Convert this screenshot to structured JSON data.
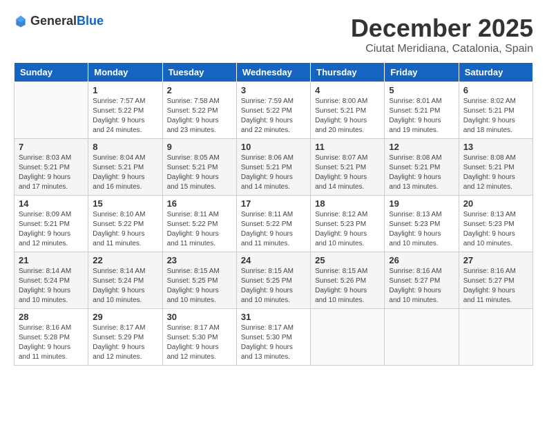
{
  "header": {
    "logo_general": "General",
    "logo_blue": "Blue",
    "month": "December 2025",
    "location": "Ciutat Meridiana, Catalonia, Spain"
  },
  "weekdays": [
    "Sunday",
    "Monday",
    "Tuesday",
    "Wednesday",
    "Thursday",
    "Friday",
    "Saturday"
  ],
  "weeks": [
    [
      {
        "day": "",
        "sunrise": "",
        "sunset": "",
        "daylight": ""
      },
      {
        "day": "1",
        "sunrise": "Sunrise: 7:57 AM",
        "sunset": "Sunset: 5:22 PM",
        "daylight": "Daylight: 9 hours and 24 minutes."
      },
      {
        "day": "2",
        "sunrise": "Sunrise: 7:58 AM",
        "sunset": "Sunset: 5:22 PM",
        "daylight": "Daylight: 9 hours and 23 minutes."
      },
      {
        "day": "3",
        "sunrise": "Sunrise: 7:59 AM",
        "sunset": "Sunset: 5:22 PM",
        "daylight": "Daylight: 9 hours and 22 minutes."
      },
      {
        "day": "4",
        "sunrise": "Sunrise: 8:00 AM",
        "sunset": "Sunset: 5:21 PM",
        "daylight": "Daylight: 9 hours and 20 minutes."
      },
      {
        "day": "5",
        "sunrise": "Sunrise: 8:01 AM",
        "sunset": "Sunset: 5:21 PM",
        "daylight": "Daylight: 9 hours and 19 minutes."
      },
      {
        "day": "6",
        "sunrise": "Sunrise: 8:02 AM",
        "sunset": "Sunset: 5:21 PM",
        "daylight": "Daylight: 9 hours and 18 minutes."
      }
    ],
    [
      {
        "day": "7",
        "sunrise": "Sunrise: 8:03 AM",
        "sunset": "Sunset: 5:21 PM",
        "daylight": "Daylight: 9 hours and 17 minutes."
      },
      {
        "day": "8",
        "sunrise": "Sunrise: 8:04 AM",
        "sunset": "Sunset: 5:21 PM",
        "daylight": "Daylight: 9 hours and 16 minutes."
      },
      {
        "day": "9",
        "sunrise": "Sunrise: 8:05 AM",
        "sunset": "Sunset: 5:21 PM",
        "daylight": "Daylight: 9 hours and 15 minutes."
      },
      {
        "day": "10",
        "sunrise": "Sunrise: 8:06 AM",
        "sunset": "Sunset: 5:21 PM",
        "daylight": "Daylight: 9 hours and 14 minutes."
      },
      {
        "day": "11",
        "sunrise": "Sunrise: 8:07 AM",
        "sunset": "Sunset: 5:21 PM",
        "daylight": "Daylight: 9 hours and 14 minutes."
      },
      {
        "day": "12",
        "sunrise": "Sunrise: 8:08 AM",
        "sunset": "Sunset: 5:21 PM",
        "daylight": "Daylight: 9 hours and 13 minutes."
      },
      {
        "day": "13",
        "sunrise": "Sunrise: 8:08 AM",
        "sunset": "Sunset: 5:21 PM",
        "daylight": "Daylight: 9 hours and 12 minutes."
      }
    ],
    [
      {
        "day": "14",
        "sunrise": "Sunrise: 8:09 AM",
        "sunset": "Sunset: 5:21 PM",
        "daylight": "Daylight: 9 hours and 12 minutes."
      },
      {
        "day": "15",
        "sunrise": "Sunrise: 8:10 AM",
        "sunset": "Sunset: 5:22 PM",
        "daylight": "Daylight: 9 hours and 11 minutes."
      },
      {
        "day": "16",
        "sunrise": "Sunrise: 8:11 AM",
        "sunset": "Sunset: 5:22 PM",
        "daylight": "Daylight: 9 hours and 11 minutes."
      },
      {
        "day": "17",
        "sunrise": "Sunrise: 8:11 AM",
        "sunset": "Sunset: 5:22 PM",
        "daylight": "Daylight: 9 hours and 11 minutes."
      },
      {
        "day": "18",
        "sunrise": "Sunrise: 8:12 AM",
        "sunset": "Sunset: 5:23 PM",
        "daylight": "Daylight: 9 hours and 10 minutes."
      },
      {
        "day": "19",
        "sunrise": "Sunrise: 8:13 AM",
        "sunset": "Sunset: 5:23 PM",
        "daylight": "Daylight: 9 hours and 10 minutes."
      },
      {
        "day": "20",
        "sunrise": "Sunrise: 8:13 AM",
        "sunset": "Sunset: 5:23 PM",
        "daylight": "Daylight: 9 hours and 10 minutes."
      }
    ],
    [
      {
        "day": "21",
        "sunrise": "Sunrise: 8:14 AM",
        "sunset": "Sunset: 5:24 PM",
        "daylight": "Daylight: 9 hours and 10 minutes."
      },
      {
        "day": "22",
        "sunrise": "Sunrise: 8:14 AM",
        "sunset": "Sunset: 5:24 PM",
        "daylight": "Daylight: 9 hours and 10 minutes."
      },
      {
        "day": "23",
        "sunrise": "Sunrise: 8:15 AM",
        "sunset": "Sunset: 5:25 PM",
        "daylight": "Daylight: 9 hours and 10 minutes."
      },
      {
        "day": "24",
        "sunrise": "Sunrise: 8:15 AM",
        "sunset": "Sunset: 5:25 PM",
        "daylight": "Daylight: 9 hours and 10 minutes."
      },
      {
        "day": "25",
        "sunrise": "Sunrise: 8:15 AM",
        "sunset": "Sunset: 5:26 PM",
        "daylight": "Daylight: 9 hours and 10 minutes."
      },
      {
        "day": "26",
        "sunrise": "Sunrise: 8:16 AM",
        "sunset": "Sunset: 5:27 PM",
        "daylight": "Daylight: 9 hours and 10 minutes."
      },
      {
        "day": "27",
        "sunrise": "Sunrise: 8:16 AM",
        "sunset": "Sunset: 5:27 PM",
        "daylight": "Daylight: 9 hours and 11 minutes."
      }
    ],
    [
      {
        "day": "28",
        "sunrise": "Sunrise: 8:16 AM",
        "sunset": "Sunset: 5:28 PM",
        "daylight": "Daylight: 9 hours and 11 minutes."
      },
      {
        "day": "29",
        "sunrise": "Sunrise: 8:17 AM",
        "sunset": "Sunset: 5:29 PM",
        "daylight": "Daylight: 9 hours and 12 minutes."
      },
      {
        "day": "30",
        "sunrise": "Sunrise: 8:17 AM",
        "sunset": "Sunset: 5:30 PM",
        "daylight": "Daylight: 9 hours and 12 minutes."
      },
      {
        "day": "31",
        "sunrise": "Sunrise: 8:17 AM",
        "sunset": "Sunset: 5:30 PM",
        "daylight": "Daylight: 9 hours and 13 minutes."
      },
      {
        "day": "",
        "sunrise": "",
        "sunset": "",
        "daylight": ""
      },
      {
        "day": "",
        "sunrise": "",
        "sunset": "",
        "daylight": ""
      },
      {
        "day": "",
        "sunrise": "",
        "sunset": "",
        "daylight": ""
      }
    ]
  ]
}
